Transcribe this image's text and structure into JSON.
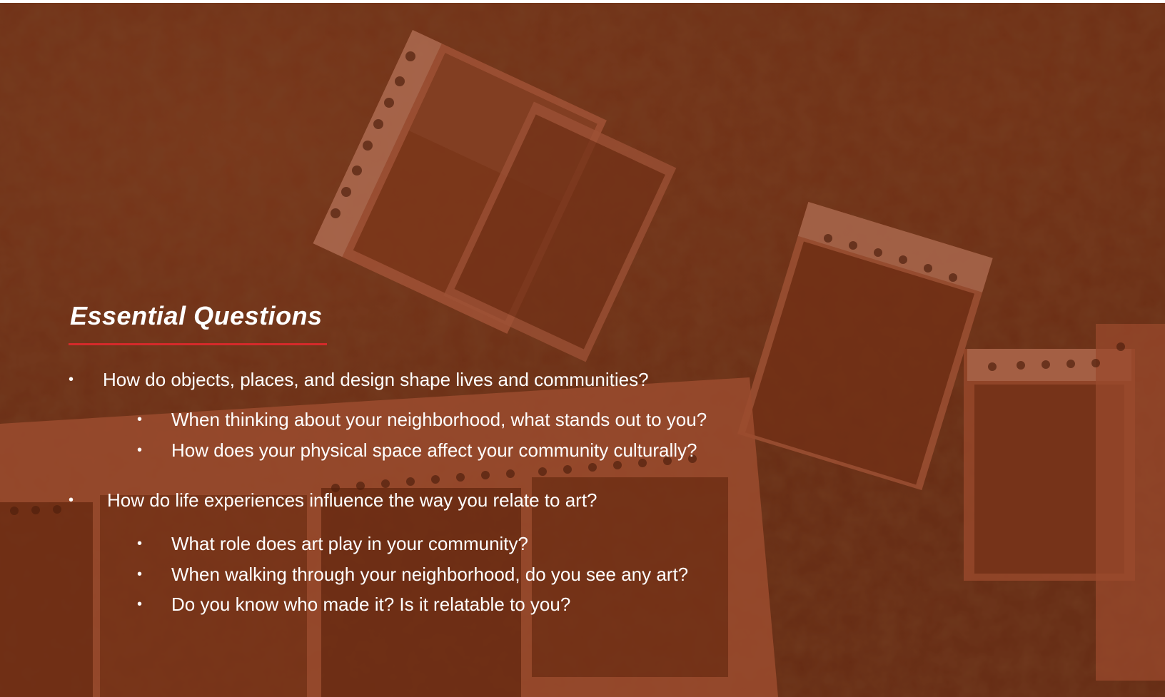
{
  "slide": {
    "title": "Essential Questions",
    "accent_color": "#d42a2a",
    "background_description_icon": "film-strip-photos-on-grass",
    "bullet_symbol": "•",
    "questions": [
      {
        "text": "How do objects, places, and design shape lives and communities?",
        "sub": [
          "When thinking about your neighborhood, what stands out to you?",
          "How does your physical space affect your community culturally?"
        ]
      },
      {
        "text": "How do life experiences influence the way you relate to art?",
        "sub": [
          "What role does art play in your community?",
          "When walking through your neighborhood, do you see any art?",
          "Do you know who made it? Is it relatable to you?"
        ]
      }
    ]
  }
}
